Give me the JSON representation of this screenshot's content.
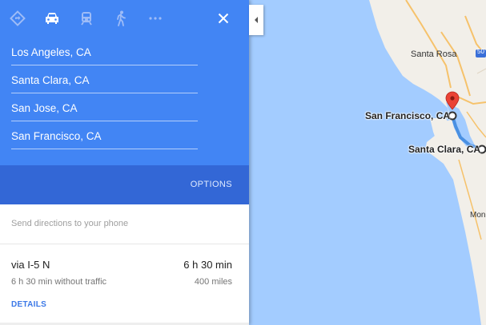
{
  "travel_modes": [
    {
      "name": "best-route",
      "icon": "directions-diamond-icon",
      "active": false
    },
    {
      "name": "driving",
      "icon": "car-icon",
      "active": true
    },
    {
      "name": "transit",
      "icon": "train-icon",
      "active": false
    },
    {
      "name": "walking",
      "icon": "walking-icon",
      "active": false
    },
    {
      "name": "more",
      "icon": "more-horiz-icon",
      "active": false
    }
  ],
  "close_icon": "close-icon",
  "waypoints": [
    "Los Angeles, CA",
    "Santa Clara, CA",
    "San Jose, CA",
    "San Francisco, CA"
  ],
  "options_label": "OPTIONS",
  "send_to_phone": "Send directions to your phone",
  "route": {
    "via": "via I-5 N",
    "duration": "6 h 30 min",
    "traffic_note": "6 h 30 min without traffic",
    "distance": "400 miles",
    "details_label": "DETAILS"
  },
  "map": {
    "labels": {
      "santa_rosa": "Santa Rosa",
      "san_francisco": "San Francisco, CA",
      "santa_clara": "Santa Clara, CA",
      "highway_shield": "50",
      "mon": "Mon"
    },
    "colors": {
      "water": "#a3ccff",
      "land": "#f2efe9",
      "route": "#4a90e2",
      "pin": "#ea4335",
      "panel_blue": "#4285f4",
      "panel_blue_dark": "#3367d6"
    }
  }
}
